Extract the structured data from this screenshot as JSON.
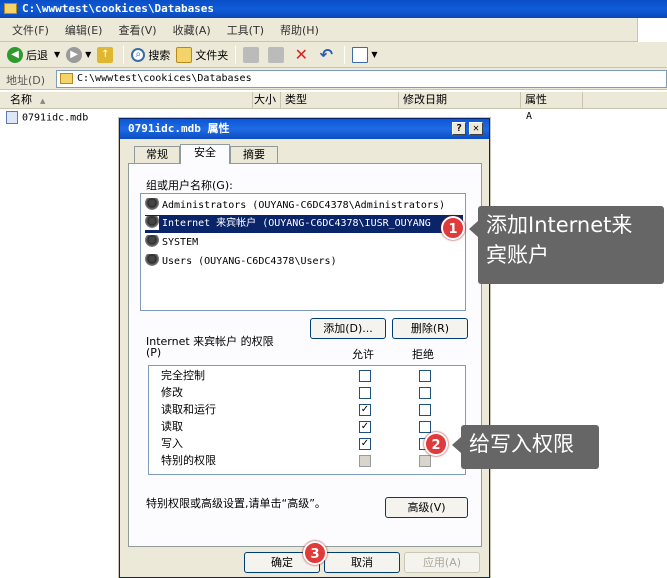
{
  "window": {
    "title": "C:\\wwwtest\\cookices\\Databases"
  },
  "menu": [
    "文件(F)",
    "编辑(E)",
    "查看(V)",
    "收藏(A)",
    "工具(T)",
    "帮助(H)"
  ],
  "toolbar": {
    "back": "后退",
    "search": "搜索",
    "folders": "文件夹"
  },
  "address": {
    "label": "地址(D)",
    "value": "C:\\wwwtest\\cookices\\Databases"
  },
  "columns": [
    "名称",
    "大小",
    "类型",
    "修改日期",
    "属性"
  ],
  "file": {
    "name": "0791idc.mdb",
    "attr": "A"
  },
  "dialog": {
    "title": "0791idc.mdb 属性",
    "tabs": [
      "常规",
      "安全",
      "摘要"
    ],
    "group_label": "组或用户名称(G):",
    "users": [
      "Administrators (OUYANG-C6DC4378\\Administrators)",
      "Internet 来宾帐户 (OUYANG-C6DC4378\\IUSR_OUYANG",
      "SYSTEM",
      "Users (OUYANG-C6DC4378\\Users)"
    ],
    "add_button": "添加(D)...",
    "remove_button": "删除(R)",
    "perm_label_1": "Internet 来宾帐户 的权限",
    "perm_label_2": "(P)",
    "allow_header": "允许",
    "deny_header": "拒绝",
    "permissions": [
      {
        "name": "完全控制",
        "allow": false,
        "deny": false
      },
      {
        "name": "修改",
        "allow": false,
        "deny": false
      },
      {
        "name": "读取和运行",
        "allow": true,
        "deny": false
      },
      {
        "name": "读取",
        "allow": true,
        "deny": false
      },
      {
        "name": "写入",
        "allow": true,
        "deny": false
      },
      {
        "name": "特别的权限",
        "allow": false,
        "deny": false
      }
    ],
    "advanced_note": "特别权限或高级设置,请单击“高级”。",
    "advanced_button": "高级(V)",
    "ok_button": "确定",
    "cancel_button": "取消",
    "apply_button": "应用(A)"
  },
  "callouts": [
    {
      "number": "1",
      "text_line1": "添加Internet来",
      "text_line2": "宾账户"
    },
    {
      "number": "2",
      "text": "给写入权限"
    },
    {
      "number": "3"
    }
  ],
  "colors": {
    "titlebar": "#0a4ec7",
    "selection": "#0a246a",
    "callout": "#666666",
    "badge": "#e03a3a"
  }
}
